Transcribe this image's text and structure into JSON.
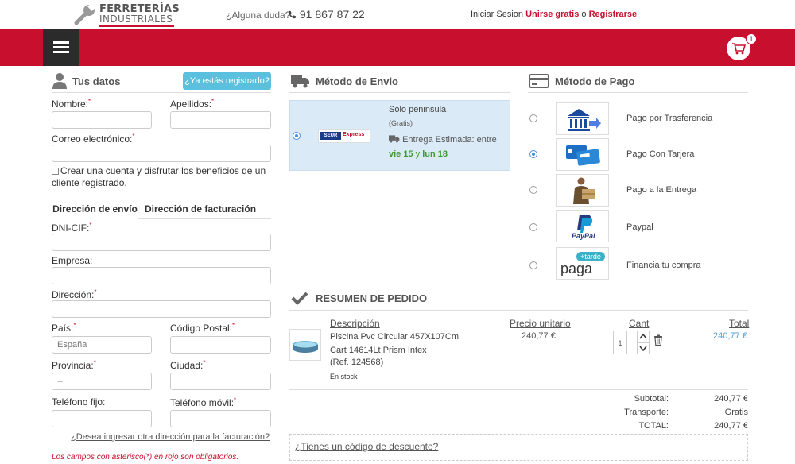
{
  "header": {
    "logo_line1": "FERRETERÍAS",
    "logo_line2": "INDUSTRIALES",
    "help_question": "¿Alguna duda?",
    "phone": "91 867 87 22",
    "login_text": "Iniciar Sesion",
    "join_text": "Unirse gratis",
    "or_text": "o",
    "register_text": "Registrarse",
    "cart_count": "1"
  },
  "colors": {
    "brand_red": "#c8102e",
    "info_blue": "#5bc0de",
    "link_blue": "#4a9fd5",
    "green": "#3c9a2c"
  },
  "customer": {
    "title": "Tus datos",
    "registered_button": "¿Ya estás registrado?",
    "name_label": "Nombre:",
    "surname_label": "Apellidos:",
    "email_label": "Correo electrónico:",
    "create_account_text": "Crear una cuenta y disfrutar los beneficios de un cliente registrado.",
    "tab_shipping": "Dirección de envío",
    "tab_billing": "Dirección de facturación",
    "dni_label": "DNI-CIF:",
    "company_label": "Empresa:",
    "address_label": "Dirección:",
    "country_label": "País:",
    "country_value": "España",
    "postal_label": "Código Postal:",
    "province_label": "Provincia:",
    "province_value": "--",
    "city_label": "Ciudad:",
    "phone_label": "Teléfono fijo:",
    "mobile_label": "Teléfono móvil:",
    "other_billing_link": "¿Desea ingresar otra dirección para la facturación?",
    "required_note": "Los campos con asterisco(*) en rojo son obligatorios."
  },
  "shipping": {
    "title": "Método de Envio",
    "carrier_logo_text_1": "SEUR",
    "carrier_logo_text_2": "Express",
    "option_name": "Solo peninsula",
    "option_price": "(Gratis)",
    "estimate_prefix": "Entrega Estimada: entre",
    "estimate_day1": "vie 15",
    "estimate_and": "y",
    "estimate_day2": "lun 18"
  },
  "payment": {
    "title": "Método de Pago",
    "options": [
      {
        "label": "Pago por Trasferencia",
        "icon": "bank-transfer-icon",
        "selected": false
      },
      {
        "label": "Pago Con Tarjera",
        "icon": "credit-card-icon",
        "selected": true
      },
      {
        "label": "Pago a la Entrega",
        "icon": "delivery-person-icon",
        "selected": false
      },
      {
        "label": "Paypal",
        "icon": "paypal-icon",
        "selected": false
      },
      {
        "label": "Financia tu compra",
        "icon": "pagamastarde-icon",
        "selected": false
      }
    ],
    "paypal_logo_text": "PayPal",
    "paga_word": "paga",
    "tarde_word": "+tarde"
  },
  "summary": {
    "title": "RESUMEN DE PEDIDO",
    "col_description": "Descripción",
    "col_unit_price": "Precio unitario",
    "col_qty": "Cant",
    "col_total": "Total",
    "item_name": "Piscina Pvc Circular 457X107Cm Cart 14614Lt Prism Intex",
    "item_ref": "(Ref. 124568)",
    "item_stock": "En stock",
    "item_unit_price": "240,77 €",
    "item_qty": "1",
    "item_total": "240,77 €",
    "subtotal_label": "Subtotal:",
    "subtotal_value": "240,77 €",
    "transport_label": "Transporte:",
    "transport_value": "Gratis",
    "total_label": "TOTAL:",
    "total_value": "240,77 €",
    "discount_link": "¿Tienes un código de descuento?"
  }
}
